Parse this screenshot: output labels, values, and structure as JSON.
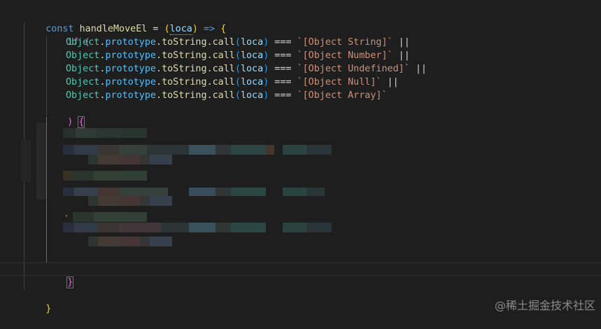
{
  "code": {
    "l1_kw": "const",
    "l1_name": "handleMoveEl",
    "l1_eq": " = ",
    "l1_param": "loca",
    "l1_arrow": " => ",
    "if_kw": "if",
    "obj": "Object",
    "proto": "prototype",
    "method": "toString",
    "call": "call",
    "param": "loca",
    "cmp": " === ",
    "or": " ||",
    "s1": "`[Object String]`",
    "s2": "`[Object Number]`",
    "s3": "`[Object Undefined]`",
    "s4": "`[Object Null]`",
    "s5": "`[Object Array]`",
    "close_paren": ")",
    "open_brace": "{",
    "close_brace": "}",
    "tick_char": "'"
  },
  "watermark": "@稀土掘金技术社区"
}
